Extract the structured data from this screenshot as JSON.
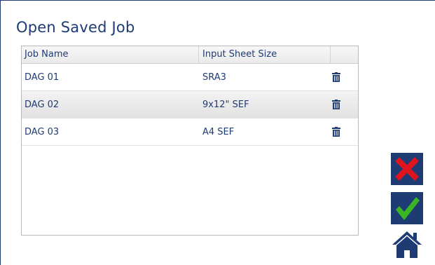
{
  "page": {
    "title": "Open Saved Job"
  },
  "table": {
    "columns": [
      "Job Name",
      "Input Sheet Size"
    ],
    "rows": [
      {
        "job_name": "DAG 01",
        "sheet_size": "SRA3",
        "action_icon": "trash-icon"
      },
      {
        "job_name": "DAG 02",
        "sheet_size": "9x12\" SEF",
        "action_icon": "trash-icon"
      },
      {
        "job_name": "DAG 03",
        "sheet_size": "A4 SEF",
        "action_icon": "trash-icon"
      }
    ],
    "selected_row": 1
  },
  "buttons": {
    "cancel_icon": "x-icon",
    "confirm_icon": "check-icon",
    "home_icon": "home-icon"
  },
  "colors": {
    "primary": "#1f3b73",
    "cancel": "#e0141e",
    "confirm": "#3ab526",
    "text": "#1f3b73"
  }
}
